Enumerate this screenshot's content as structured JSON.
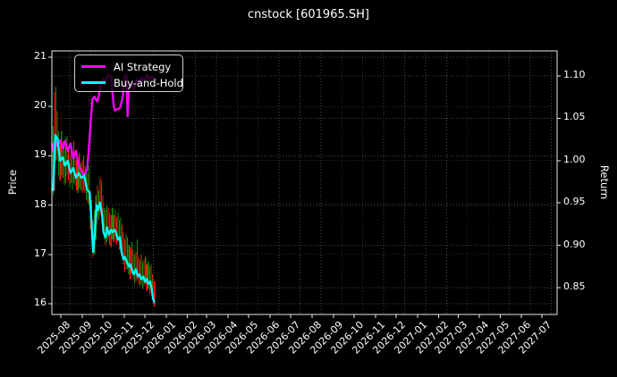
{
  "chart_data": {
    "type": "line",
    "title": "cnstock [601965.SH]",
    "ylabel_left": "Price",
    "ylabel_right": "Return",
    "x_unit": "days since 2025-08-01",
    "x_ticks": [
      {
        "d": 0,
        "label": "2025-08"
      },
      {
        "d": 31,
        "label": "2025-09"
      },
      {
        "d": 61,
        "label": "2025-10"
      },
      {
        "d": 92,
        "label": "2025-11"
      },
      {
        "d": 122,
        "label": "2025-12"
      },
      {
        "d": 153,
        "label": "2026-01"
      },
      {
        "d": 184,
        "label": "2026-02"
      },
      {
        "d": 212,
        "label": "2026-03"
      },
      {
        "d": 243,
        "label": "2026-04"
      },
      {
        "d": 273,
        "label": "2026-05"
      },
      {
        "d": 304,
        "label": "2026-06"
      },
      {
        "d": 334,
        "label": "2026-07"
      },
      {
        "d": 365,
        "label": "2026-08"
      },
      {
        "d": 396,
        "label": "2026-09"
      },
      {
        "d": 426,
        "label": "2026-10"
      },
      {
        "d": 457,
        "label": "2026-11"
      },
      {
        "d": 487,
        "label": "2026-12"
      },
      {
        "d": 518,
        "label": "2027-01"
      },
      {
        "d": 549,
        "label": "2027-02"
      },
      {
        "d": 577,
        "label": "2027-03"
      },
      {
        "d": 608,
        "label": "2027-04"
      },
      {
        "d": 638,
        "label": "2027-05"
      },
      {
        "d": 669,
        "label": "2027-06"
      },
      {
        "d": 699,
        "label": "2027-07"
      }
    ],
    "y_left_ticks": [
      {
        "v": 16,
        "label": "16"
      },
      {
        "v": 17,
        "label": "17"
      },
      {
        "v": 18,
        "label": "18"
      },
      {
        "v": 19,
        "label": "19"
      },
      {
        "v": 20,
        "label": "20"
      },
      {
        "v": 21,
        "label": "21"
      }
    ],
    "y_right_ticks": [
      {
        "v": 0.85,
        "label": "0.85"
      },
      {
        "v": 0.9,
        "label": "0.90"
      },
      {
        "v": 0.95,
        "label": "0.95"
      },
      {
        "v": 1.0,
        "label": "1.00"
      },
      {
        "v": 1.05,
        "label": "1.05"
      },
      {
        "v": 1.1,
        "label": "1.10"
      }
    ],
    "x_grid": {
      "offset_days": 13,
      "step_days": 30.4,
      "count": 24
    },
    "legend": {
      "position": "upper left",
      "items": [
        {
          "label": "AI Strategy",
          "color": "#ff00ff"
        },
        {
          "label": "Buy-and-Hold",
          "color": "#00ffff"
        }
      ]
    },
    "series": [
      {
        "name": "AI Strategy",
        "color": "#ff00ff",
        "points": [
          [
            -13,
            19.25
          ],
          [
            -11,
            19.1
          ],
          [
            -8,
            19.3
          ],
          [
            -5,
            19.2
          ],
          [
            -1,
            19.32
          ],
          [
            3,
            19.15
          ],
          [
            6,
            19.3
          ],
          [
            10,
            19.1
          ],
          [
            14,
            19.25
          ],
          [
            18,
            18.95
          ],
          [
            22,
            19.1
          ],
          [
            26,
            18.8
          ],
          [
            30,
            18.7
          ],
          [
            34,
            18.6
          ],
          [
            38,
            18.72
          ],
          [
            40,
            19.0
          ],
          [
            43,
            19.6
          ],
          [
            46,
            20.15
          ],
          [
            49,
            20.2
          ],
          [
            53,
            20.1
          ],
          [
            55,
            20.2
          ],
          [
            58,
            20.45
          ],
          [
            62,
            20.55
          ],
          [
            65,
            20.5
          ],
          [
            69,
            20.65
          ],
          [
            73,
            20.6
          ],
          [
            77,
            20.0
          ],
          [
            79,
            19.92
          ],
          [
            83,
            19.95
          ],
          [
            86,
            19.97
          ],
          [
            90,
            20.2
          ],
          [
            93,
            20.6
          ],
          [
            95,
            20.65
          ],
          [
            97,
            19.8
          ],
          [
            99,
            20.4
          ],
          [
            103,
            20.5
          ],
          [
            106,
            20.35
          ],
          [
            110,
            20.55
          ],
          [
            114,
            20.45
          ],
          [
            117,
            20.6
          ],
          [
            121,
            20.5
          ],
          [
            125,
            20.65
          ],
          [
            128,
            20.55
          ],
          [
            132,
            20.6
          ],
          [
            136,
            20.55
          ]
        ]
      },
      {
        "name": "Buy-and-Hold",
        "color": "#00ffff",
        "points": [
          [
            -13,
            18.35
          ],
          [
            -11,
            18.3
          ],
          [
            -8,
            19.42
          ],
          [
            -5,
            19.35
          ],
          [
            -1,
            18.9
          ],
          [
            3,
            18.97
          ],
          [
            6,
            18.8
          ],
          [
            10,
            18.9
          ],
          [
            14,
            18.65
          ],
          [
            18,
            18.75
          ],
          [
            22,
            18.55
          ],
          [
            26,
            18.65
          ],
          [
            30,
            18.55
          ],
          [
            34,
            18.6
          ],
          [
            38,
            18.32
          ],
          [
            42,
            18.25
          ],
          [
            44,
            17.8
          ],
          [
            47,
            17.05
          ],
          [
            49,
            17.35
          ],
          [
            52,
            18.0
          ],
          [
            54,
            17.9
          ],
          [
            57,
            18.05
          ],
          [
            60,
            17.8
          ],
          [
            62,
            17.45
          ],
          [
            65,
            17.35
          ],
          [
            67,
            17.55
          ],
          [
            70,
            17.4
          ],
          [
            73,
            17.5
          ],
          [
            75,
            17.45
          ],
          [
            78,
            17.5
          ],
          [
            80,
            17.45
          ],
          [
            83,
            17.3
          ],
          [
            86,
            17.35
          ],
          [
            88,
            17.05
          ],
          [
            91,
            16.9
          ],
          [
            93,
            16.95
          ],
          [
            96,
            16.85
          ],
          [
            99,
            16.75
          ],
          [
            101,
            16.8
          ],
          [
            104,
            16.65
          ],
          [
            106,
            16.6
          ],
          [
            109,
            16.7
          ],
          [
            112,
            16.55
          ],
          [
            114,
            16.6
          ],
          [
            117,
            16.5
          ],
          [
            120,
            16.55
          ],
          [
            122,
            16.45
          ],
          [
            125,
            16.5
          ],
          [
            127,
            16.4
          ],
          [
            130,
            16.45
          ],
          [
            132,
            16.3
          ],
          [
            134,
            16.1
          ],
          [
            136,
            16.02
          ]
        ]
      }
    ],
    "price_bars": {
      "bar_colors": {
        "r": "#ff1a0e",
        "g": "#089000"
      },
      "bars": [
        [
          -13,
          17.9,
          18.6,
          "r"
        ],
        [
          -11,
          18.2,
          19.6,
          "g"
        ],
        [
          -9,
          18.3,
          20.3,
          "r"
        ],
        [
          -7,
          18.9,
          20.4,
          "g"
        ],
        [
          -5,
          18.9,
          19.9,
          "r"
        ],
        [
          -3,
          18.6,
          19.5,
          "g"
        ],
        [
          -1,
          18.5,
          19.3,
          "r"
        ],
        [
          1,
          18.6,
          19.5,
          "g"
        ],
        [
          3,
          18.55,
          19.3,
          "r"
        ],
        [
          5,
          18.4,
          19.2,
          "g"
        ],
        [
          7,
          18.45,
          19.35,
          "r"
        ],
        [
          9,
          18.6,
          19.4,
          "g"
        ],
        [
          11,
          18.5,
          19.2,
          "r"
        ],
        [
          13,
          18.35,
          19.0,
          "g"
        ],
        [
          15,
          18.45,
          19.25,
          "r"
        ],
        [
          17,
          18.3,
          18.95,
          "g"
        ],
        [
          19,
          18.45,
          19.3,
          "r"
        ],
        [
          21,
          18.4,
          19.05,
          "g"
        ],
        [
          23,
          18.3,
          18.9,
          "r"
        ],
        [
          25,
          18.25,
          18.85,
          "g"
        ],
        [
          27,
          18.35,
          19.05,
          "r"
        ],
        [
          29,
          18.3,
          18.85,
          "g"
        ],
        [
          31,
          18.25,
          18.9,
          "r"
        ],
        [
          33,
          18.3,
          19.0,
          "g"
        ],
        [
          35,
          18.25,
          18.8,
          "r"
        ],
        [
          37,
          18.1,
          18.7,
          "g"
        ],
        [
          39,
          18.05,
          18.65,
          "r"
        ],
        [
          41,
          18.0,
          18.8,
          "g"
        ],
        [
          43,
          17.5,
          18.3,
          "r"
        ],
        [
          45,
          17.3,
          18.1,
          "r"
        ],
        [
          47,
          16.95,
          17.7,
          "r"
        ],
        [
          49,
          17.0,
          17.9,
          "g"
        ],
        [
          51,
          17.3,
          18.2,
          "g"
        ],
        [
          53,
          17.6,
          18.4,
          "r"
        ],
        [
          55,
          17.7,
          18.3,
          "g"
        ],
        [
          57,
          17.8,
          18.55,
          "r"
        ],
        [
          59,
          17.75,
          18.5,
          "g"
        ],
        [
          61,
          17.5,
          18.2,
          "r"
        ],
        [
          63,
          17.3,
          17.95,
          "g"
        ],
        [
          65,
          17.2,
          17.9,
          "r"
        ],
        [
          67,
          17.25,
          18.0,
          "g"
        ],
        [
          69,
          17.3,
          17.95,
          "r"
        ],
        [
          71,
          17.2,
          17.85,
          "g"
        ],
        [
          73,
          17.15,
          17.8,
          "r"
        ],
        [
          75,
          17.3,
          17.95,
          "g"
        ],
        [
          77,
          17.25,
          17.8,
          "r"
        ],
        [
          79,
          17.3,
          17.9,
          "g"
        ],
        [
          81,
          17.2,
          17.75,
          "r"
        ],
        [
          83,
          17.25,
          17.85,
          "g"
        ],
        [
          85,
          17.1,
          17.7,
          "r"
        ],
        [
          87,
          17.15,
          17.75,
          "g"
        ],
        [
          89,
          16.95,
          17.6,
          "r"
        ],
        [
          91,
          16.8,
          17.45,
          "g"
        ],
        [
          93,
          16.65,
          17.3,
          "r"
        ],
        [
          95,
          16.7,
          17.4,
          "g"
        ],
        [
          97,
          16.7,
          17.35,
          "r"
        ],
        [
          99,
          16.6,
          17.2,
          "g"
        ],
        [
          101,
          16.5,
          17.15,
          "r"
        ],
        [
          103,
          16.6,
          17.25,
          "g"
        ],
        [
          105,
          16.5,
          17.1,
          "r"
        ],
        [
          107,
          16.4,
          17.0,
          "g"
        ],
        [
          109,
          16.45,
          17.05,
          "r"
        ],
        [
          111,
          16.5,
          17.3,
          "g"
        ],
        [
          113,
          16.4,
          16.95,
          "r"
        ],
        [
          115,
          16.35,
          16.9,
          "g"
        ],
        [
          117,
          16.4,
          17.0,
          "r"
        ],
        [
          119,
          16.3,
          16.85,
          "g"
        ],
        [
          121,
          16.35,
          16.9,
          "r"
        ],
        [
          123,
          16.4,
          16.95,
          "g"
        ],
        [
          125,
          16.25,
          16.8,
          "r"
        ],
        [
          127,
          16.3,
          16.85,
          "g"
        ],
        [
          129,
          16.2,
          16.75,
          "r"
        ],
        [
          131,
          16.25,
          16.8,
          "g"
        ],
        [
          133,
          16.1,
          16.6,
          "r"
        ],
        [
          134,
          16.05,
          16.5,
          "g"
        ],
        [
          136,
          15.95,
          16.45,
          "r"
        ]
      ]
    },
    "axes_note": "left axis Price 16-21, right axis Return 0.85-1.10; price 18.85 aligns with return 1.00"
  },
  "colors": {
    "background": "#000000",
    "text": "#ffffff",
    "grid": "#4f4f4f",
    "spine": "#e8e8e8",
    "ai_strategy": "#ff00ff",
    "buy_and_hold": "#00ffff",
    "bar_down": "#ff1a0e",
    "bar_up": "#089000"
  }
}
